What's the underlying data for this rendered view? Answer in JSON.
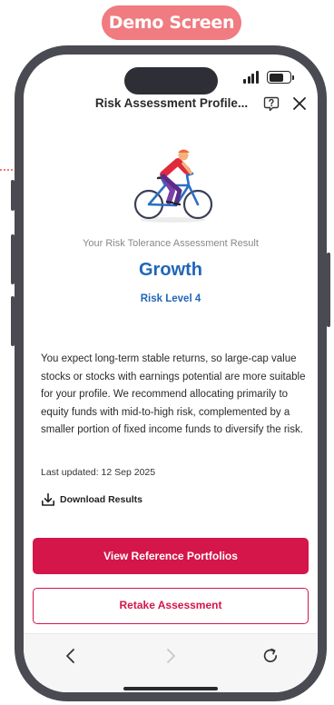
{
  "demo_label": "Demo Screen",
  "header": {
    "title": "Risk Assessment Profile..."
  },
  "icons": {
    "help": "help-icon",
    "close": "close-icon",
    "illustration": "cyclist-illustration",
    "download": "download-icon",
    "back": "chevron-left-icon",
    "forward": "chevron-right-icon",
    "reload": "reload-icon"
  },
  "result": {
    "caption": "Your Risk Tolerance Assessment Result",
    "profile": "Growth",
    "risk_level": "Risk Level 4",
    "description": "You expect long-term stable returns, so large-cap value stocks or stocks with earnings potential are more suitable for your profile. We recommend allocating primarily to equity funds with mid-to-high risk, complemented by a smaller portion of fixed income funds to diversify the risk.",
    "last_updated": "Last updated: 12 Sep 2025"
  },
  "actions": {
    "download_label": "Download Results",
    "primary_label": "View Reference Portfolios",
    "secondary_label": "Retake Assessment"
  },
  "colors": {
    "accent": "#d4164a",
    "profile_blue": "#2166b8",
    "demo_pill": "#f07b80",
    "frame": "#4a4a52"
  }
}
